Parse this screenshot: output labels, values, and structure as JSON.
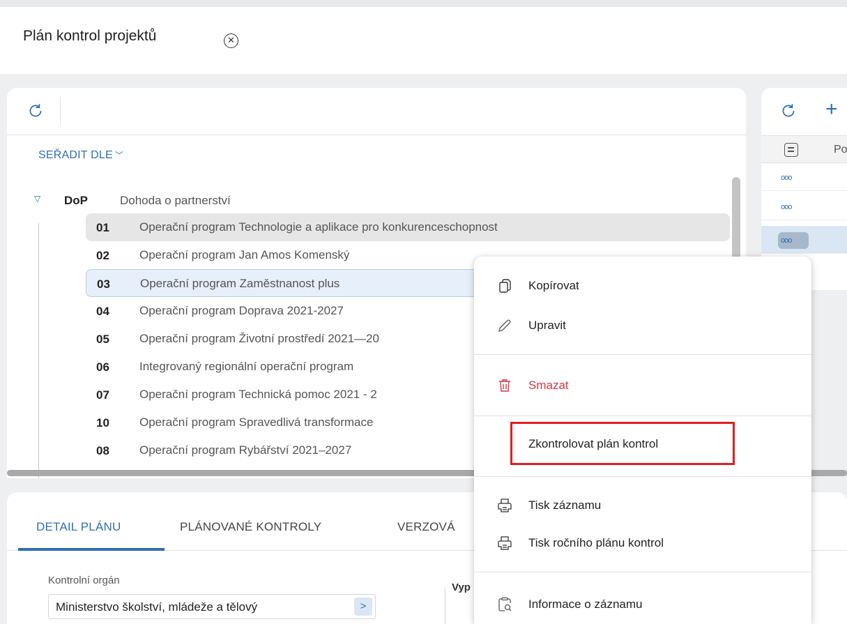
{
  "page": {
    "title": "Plán kontrol projektů"
  },
  "left_panel": {
    "sort_label": "SEŘADIT DLE",
    "tree": {
      "root": {
        "code": "DoP",
        "name": "Dohoda o partnerství"
      },
      "items": [
        {
          "code": "01",
          "name": "Operační program Technologie a aplikace pro konkurenceschopnost"
        },
        {
          "code": "02",
          "name": "Operační program Jan Amos Komenský"
        },
        {
          "code": "03",
          "name": "Operační program Zaměstnanost plus"
        },
        {
          "code": "04",
          "name": "Operační program Doprava 2021-2027"
        },
        {
          "code": "05",
          "name": "Operační program Životní prostředí 2021—20"
        },
        {
          "code": "06",
          "name": "Integrovaný regionální operační program"
        },
        {
          "code": "07",
          "name": "Operační program Technická pomoc 2021 - 2"
        },
        {
          "code": "10",
          "name": "Operační program Spravedlivá transformace"
        },
        {
          "code": "08",
          "name": "Operační program Rybářství 2021–2027"
        }
      ]
    }
  },
  "right_panel": {
    "column_header": "Po",
    "row_action": "ooo"
  },
  "context_menu": {
    "items": [
      {
        "label": "Kopírovat",
        "icon": "copy-icon"
      },
      {
        "label": "Upravit",
        "icon": "pencil-icon"
      },
      {
        "label": "Smazat",
        "icon": "trash-icon"
      },
      {
        "label": "Zkontrolovat plán kontrol"
      },
      {
        "label": "Tisk záznamu",
        "icon": "print-icon"
      },
      {
        "label": "Tisk ročního plánu kontrol",
        "icon": "print-icon"
      },
      {
        "label": "Informace o záznamu",
        "icon": "info-search-icon"
      }
    ]
  },
  "bottom_panel": {
    "tabs": [
      "DETAIL PLÁNU",
      "PLÁNOVANÉ KONTROLY",
      "VERZOVÁ"
    ],
    "field": {
      "label": "Kontrolní orgán",
      "value": "Ministerstvo školství, mládeže a tělový"
    },
    "fieldset_legend": "Vyp"
  },
  "colors": {
    "accent": "#2f6fb2",
    "danger": "#d9363e",
    "highlight": "#e01f1f"
  }
}
